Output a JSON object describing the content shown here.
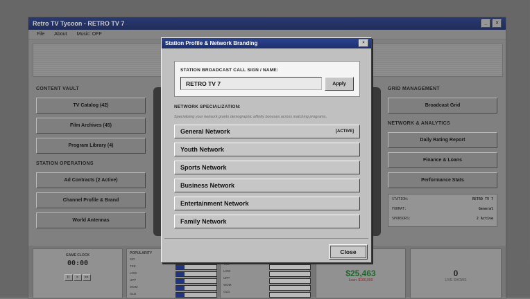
{
  "app": {
    "title": "Retro TV Tycoon - RETRO TV 7",
    "menu": [
      "File",
      "About",
      "Music: OFF"
    ]
  },
  "left_panel": {
    "content_vault_heading": "CONTENT VAULT",
    "content_vault": [
      "TV Catalog (42)",
      "Film Archives (45)",
      "Program Library (4)"
    ],
    "station_ops_heading": "STATION OPERATIONS",
    "station_ops": [
      "Ad Contracts (2 Active)",
      "Channel Profile & Brand",
      "World Antennas"
    ]
  },
  "right_panel": {
    "grid_heading": "GRID MANAGEMENT",
    "grid_button": "Broadcast Grid",
    "network_heading": "NETWORK & ANALYTICS",
    "network_buttons": [
      "Daily Rating Report",
      "Finance & Loans",
      "Performance Stats"
    ],
    "info": [
      {
        "label": "STATION:",
        "value": "RETRO TV 7"
      },
      {
        "label": "FORMAT:",
        "value": "General"
      },
      {
        "label": "SPONSORS:",
        "value": "2 Active"
      }
    ]
  },
  "bottom": {
    "clock_label": "GAME CLOCK",
    "clock_value": "00:00",
    "speed_buttons": [
      "II",
      ">",
      ">>"
    ],
    "popularity_label": "POPULARITY",
    "pop_rows": [
      {
        "label": "KID",
        "level": 0.0
      },
      {
        "label": "TEE",
        "level": 0.2
      },
      {
        "label": "LOW",
        "level": 0.2
      },
      {
        "label": "UPP",
        "level": 0.2
      },
      {
        "label": "WOM",
        "level": 0.2
      },
      {
        "label": "OLD",
        "level": 0.2
      }
    ],
    "pop_rows_2": [
      {
        "label": "TEE"
      },
      {
        "label": "LOW"
      },
      {
        "label": "UPP"
      },
      {
        "label": "WOM"
      },
      {
        "label": "OLD"
      }
    ],
    "cash": "$25,463",
    "loan": "Loan: $100,000",
    "live_count": "0",
    "live_label": "LIVE SHOWS"
  },
  "modal": {
    "title": "Station Profile & Network Branding",
    "close_glyph": "×",
    "call_sign_label": "STATION BROADCAST CALL SIGN / NAME:",
    "call_sign_value": "RETRO TV 7",
    "apply_label": "Apply",
    "specialization_label": "NETWORK SPECIALIZATION:",
    "specialization_hint": "Specializing your network grants demographic affinity bonuses across matching programs.",
    "networks": [
      {
        "label": "General Network",
        "badge": "[ACTIVE]"
      },
      {
        "label": "Youth Network",
        "badge": ""
      },
      {
        "label": "Sports Network",
        "badge": ""
      },
      {
        "label": "Business Network",
        "badge": ""
      },
      {
        "label": "Entertainment Network",
        "badge": ""
      },
      {
        "label": "Family Network",
        "badge": ""
      }
    ],
    "close_label": "Close"
  }
}
